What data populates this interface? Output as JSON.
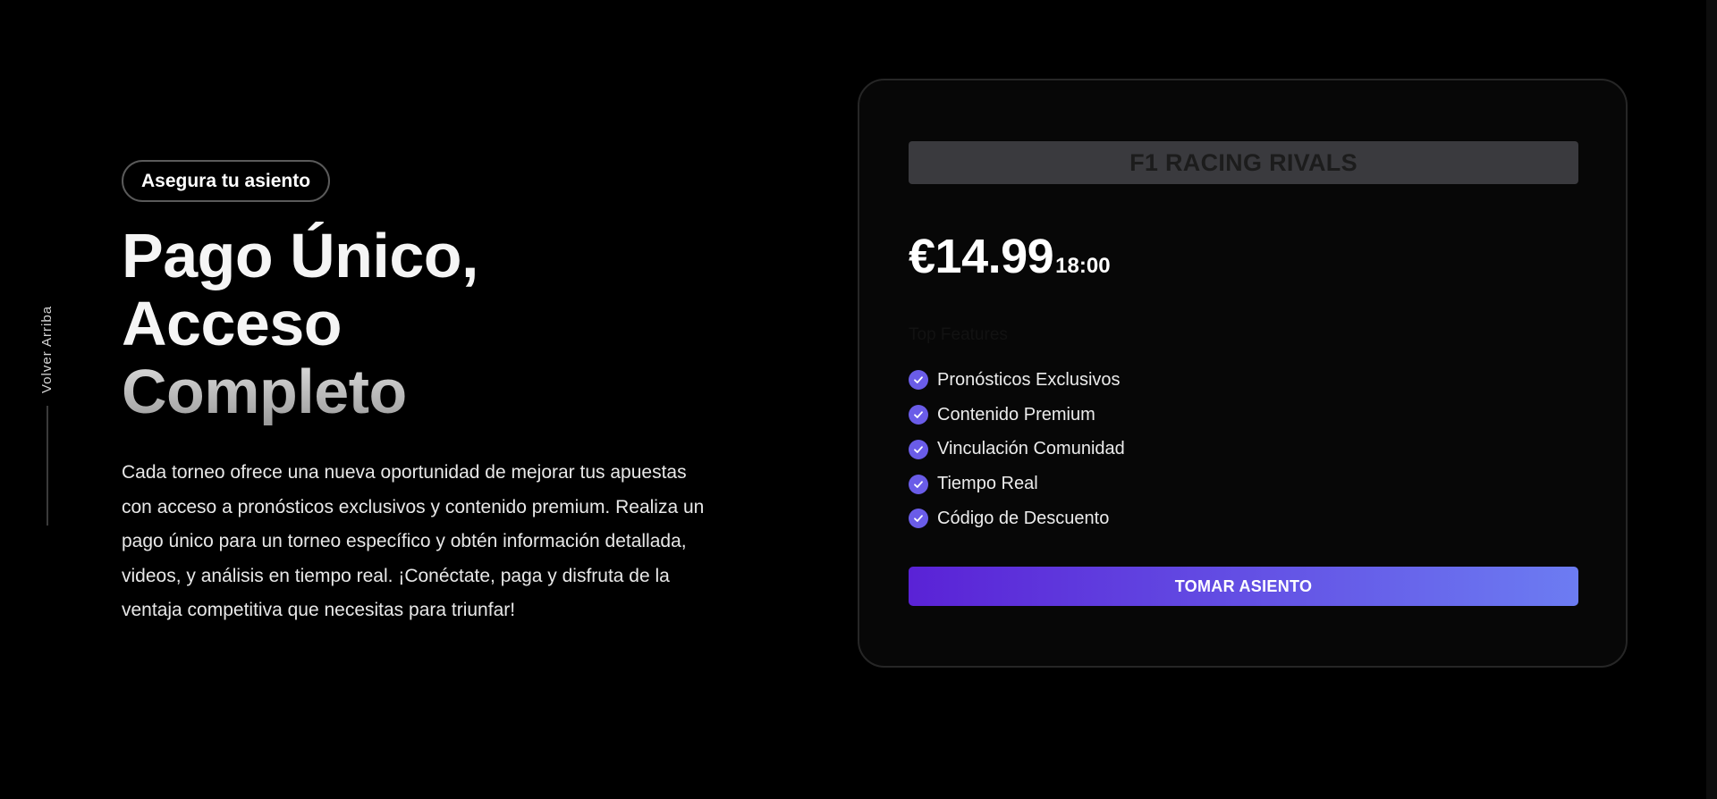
{
  "back_to_top": {
    "label": "Volver Arriba"
  },
  "hero": {
    "badge": "Asegura tu asiento",
    "headline_line1": "Pago Único, Acceso",
    "headline_line2": "Completo",
    "description": "Cada torneo ofrece una nueva oportunidad de mejorar tus apuestas con acceso a pronósticos exclusivos y contenido premium. Realiza un pago único para un torneo específico y obtén información detallada, videos, y análisis en tiempo real. ¡Conéctate, paga y disfruta de la ventaja competitiva que necesitas para triunfar!"
  },
  "card": {
    "title": "F1 RACING RIVALS",
    "price": "€14.99",
    "time": "18:00",
    "features_title": "Top Features",
    "features": [
      "Pronósticos Exclusivos",
      "Contenido Premium",
      "Vinculación Comunidad",
      "Tiempo Real",
      "Código de Descuento"
    ],
    "cta_label": "TOMAR ASIENTO",
    "check_icon": "check-circle-icon"
  },
  "colors": {
    "background": "#000000",
    "accent_start": "#5a22d6",
    "accent_end": "#6c7cf2",
    "check": "#6a5ce8"
  }
}
